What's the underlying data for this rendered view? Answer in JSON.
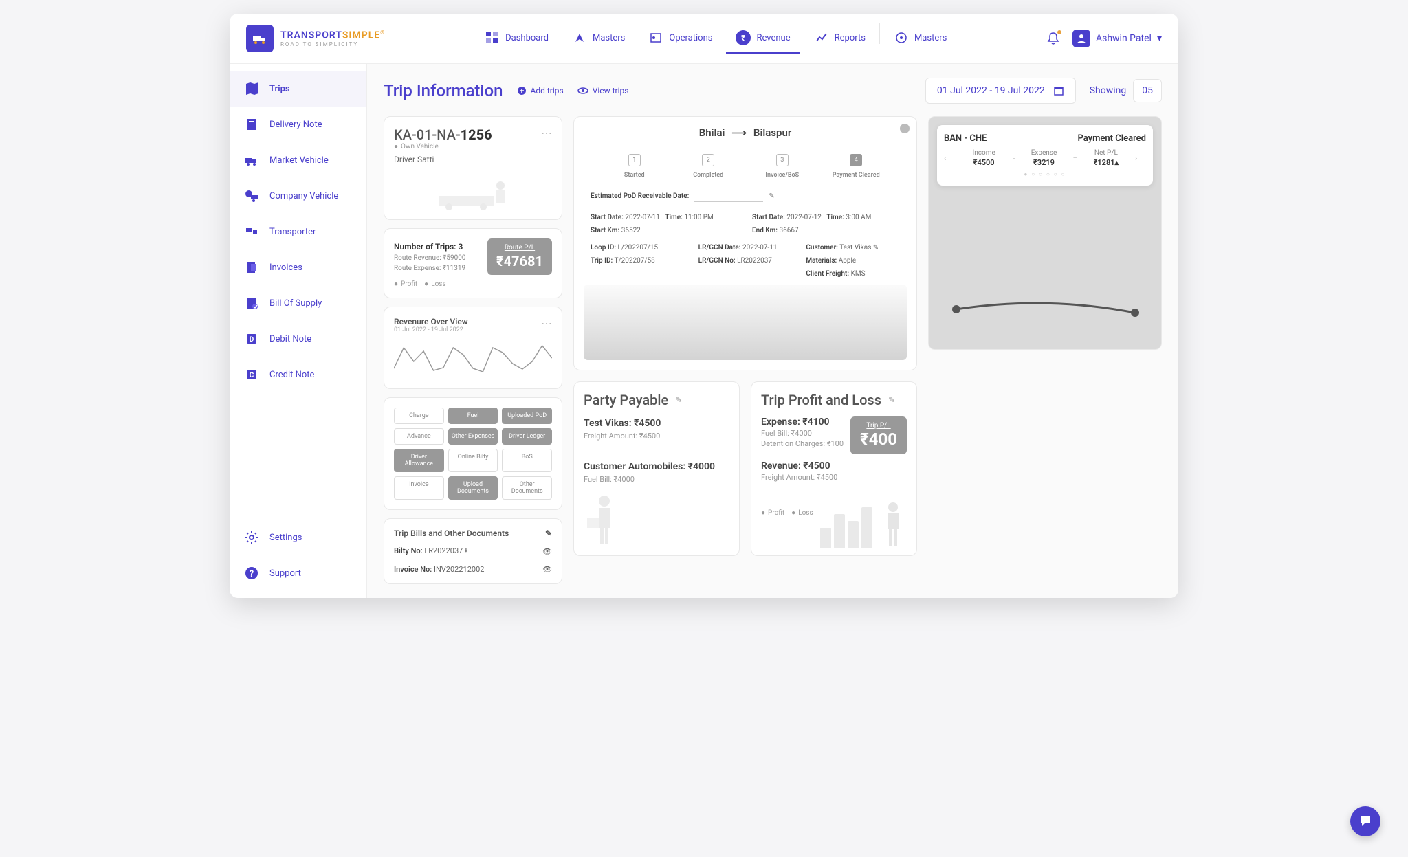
{
  "brand": {
    "name1": "TRANSPORT",
    "name2": "SIMPLE",
    "tagline": "ROAD TO SIMPLICITY"
  },
  "nav": {
    "dashboard": "Dashboard",
    "masters": "Masters",
    "operations": "Operations",
    "revenue": "Revenue",
    "reports": "Reports",
    "masters2": "Masters"
  },
  "user": {
    "name": "Ashwin Patel"
  },
  "sidebar": {
    "trips": "Trips",
    "delivery_note": "Delivery Note",
    "market_vehicle": "Market Vehicle",
    "company_vehicle": "Company Vehicle",
    "transporter": "Transporter",
    "invoices": "Invoices",
    "bos": "Bill Of Supply",
    "debit": "Debit Note",
    "credit": "Credit Note",
    "settings": "Settings",
    "support": "Support"
  },
  "page": {
    "title": "Trip Information",
    "add": "Add trips",
    "view": "View trips",
    "date_range": "01 Jul 2022 - 19 Jul 2022",
    "showing": "Showing",
    "showing_count": "05"
  },
  "vehicle": {
    "plate_prefix": "KA-01-NA-",
    "plate_num": "1256",
    "type": "Own Vehicle",
    "driver": "Driver Satti"
  },
  "trips_summary": {
    "num_label": "Number of Trips: 3",
    "rev": "Route Revenue: ₹59000",
    "exp": "Route Expense: ₹11319",
    "route_pl_label": "Route P/L",
    "route_pl_value": "₹47681",
    "legend_profit": "Profit",
    "legend_loss": "Loss"
  },
  "revenue_overview": {
    "title": "Revenure Over View",
    "range": "01 Jul 2022 - 19 Jul 2022"
  },
  "chips": {
    "charge": "Charge",
    "fuel": "Fuel",
    "uploaded_pod": "Uploaded PoD",
    "advance": "Advance",
    "other_exp": "Other Expenses",
    "driver_ledger": "Driver Ledger",
    "driver_allow": "Driver Allowance",
    "online_bilty": "Online Bilty",
    "bos": "BoS",
    "invoice": "Invoice",
    "upload_docs": "Upload Documents",
    "other_docs": "Other Documents"
  },
  "docs": {
    "title": "Trip Bills and Other Documents",
    "bilty_label": "Bilty No:",
    "bilty_val": "LR2022037",
    "invoice_label": "Invoice No:",
    "invoice_val": "INV202212002"
  },
  "route": {
    "from": "Bhilai",
    "to": "Bilaspur",
    "steps": {
      "s1": "Started",
      "s2": "Completed",
      "s3": "Invoice/BoS",
      "s4": "Payment Cleared"
    }
  },
  "detail": {
    "pod_label": "Estimated PoD Receivable Date:",
    "sd_label": "Start Date:",
    "sd_val": "2022-07-11",
    "st_label": "Time:",
    "st_val": "11:00 PM",
    "sk_label": "Start Km:",
    "sk_val": "36522",
    "ed_label": "Start Date:",
    "ed_val": "2022-07-12",
    "et_label": "Time:",
    "et_val": "3:00 AM",
    "ek_label": "End Km:",
    "ek_val": "36667",
    "loop_label": "Loop ID:",
    "loop_val": "L/202207/15",
    "trip_label": "Trip ID:",
    "trip_val": "T/202207/58",
    "lrd_label": "LR/GCN Date:",
    "lrd_val": "2022-07-11",
    "lrn_label": "LR/GCN No:",
    "lrn_val": "LR2022037",
    "cust_label": "Customer:",
    "cust_val": "Test Vikas",
    "mat_label": "Materials:",
    "mat_val": "Apple",
    "cf_label": "Client Freight:",
    "cf_val": "KMS"
  },
  "party": {
    "title": "Party Payable",
    "p1_name": "Test Vikas: ₹4500",
    "p1_sub": "Freight Amount: ₹4500",
    "p2_name": "Customer Automobiles: ₹4000",
    "p2_sub": "Fuel Bill: ₹4000"
  },
  "pl": {
    "title": "Trip Profit and Loss",
    "exp": "Expense: ₹4100",
    "exp_sub1": "Fuel Bill: ₹4000",
    "exp_sub2": "Detention Charges: ₹100",
    "rev": "Revenue: ₹4500",
    "rev_sub": "Freight Amount: ₹4500",
    "box_label": "Trip P/L",
    "box_val": "₹400",
    "legend_profit": "Profit",
    "legend_loss": "Loss"
  },
  "map_overlay": {
    "route": "BAN - CHE",
    "status": "Payment Cleared",
    "income_lbl": "Income",
    "income_val": "₹4500",
    "expense_lbl": "Expense",
    "expense_val": "₹3219",
    "netpl_lbl": "Net P/L",
    "netpl_val": "₹1281▴",
    "minus": "-",
    "equals": "="
  },
  "chart_data": {
    "type": "line",
    "title": "Revenure Over View",
    "xlabel": "",
    "ylabel": "",
    "x": [
      1,
      2,
      3,
      4,
      5,
      6,
      7,
      8,
      9,
      10,
      11,
      12,
      13,
      14,
      15,
      16,
      17,
      18,
      19
    ],
    "values": [
      20,
      60,
      35,
      55,
      20,
      25,
      60,
      45,
      25,
      15,
      60,
      50,
      30,
      20,
      35,
      65,
      55,
      20,
      45
    ],
    "ylim": [
      0,
      100
    ]
  }
}
